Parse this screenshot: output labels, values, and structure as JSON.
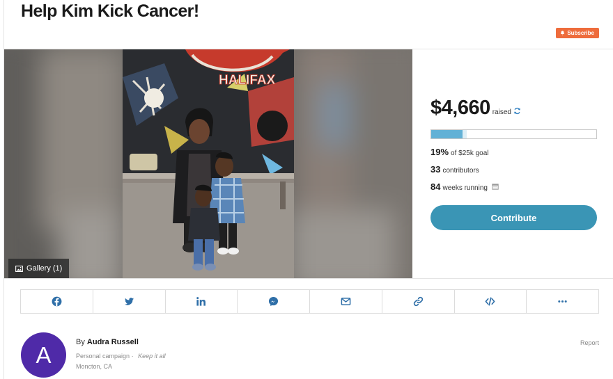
{
  "campaign": {
    "title": "Help Kim Kick Cancer!",
    "subscribe_label": "Subscribe"
  },
  "hero": {
    "gallery_label": "Gallery (1)",
    "mural_text": "HALIFAX"
  },
  "stats": {
    "amount": "$4,660",
    "raised_label": "raised",
    "progress_fraction": 0.19,
    "percent": "19%",
    "goal_label": "of $25k goal",
    "contributors_count": "33",
    "contributors_label": "contributors",
    "weeks_count": "84",
    "weeks_label": "weeks running",
    "contribute_label": "Contribute"
  },
  "share": {
    "buttons": [
      "facebook-icon",
      "twitter-icon",
      "linkedin-icon",
      "messenger-icon",
      "email-icon",
      "link-icon",
      "embed-icon",
      "more-icon"
    ]
  },
  "organizer": {
    "avatar_letter": "A",
    "by_label": "By",
    "name": "Audra Russell",
    "campaign_type": "Personal campaign",
    "funding_type": "Keep it all",
    "location": "Moncton, CA",
    "report_label": "Report"
  },
  "colors": {
    "accent": "#3a95b5",
    "progress": "#62b1d6",
    "subscribe": "#ee6c3c",
    "avatar": "#4f2aa8"
  }
}
